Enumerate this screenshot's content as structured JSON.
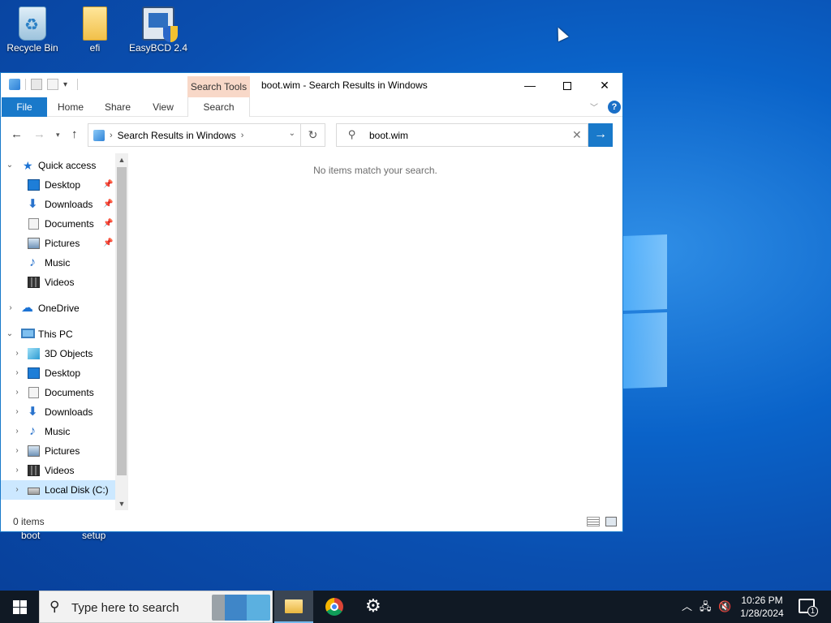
{
  "desktop": {
    "icons": [
      {
        "label": "Recycle Bin",
        "icon": "recycle-bin-icon"
      },
      {
        "label": "efi",
        "icon": "folder-icon"
      },
      {
        "label": "EasyBCD 2.4",
        "icon": "easybcd-icon"
      }
    ],
    "hidden_labels": [
      "boot",
      "setup"
    ]
  },
  "window": {
    "title": "boot.wim - Search Results in Windows",
    "context_tab": "Search Tools",
    "ribbon_tabs": [
      "File",
      "Home",
      "Share",
      "View",
      "Search"
    ],
    "help": "?",
    "address": {
      "location": "Search Results in Windows"
    },
    "search": {
      "value": "boot.wim"
    },
    "empty_message": "No items match your search.",
    "status": {
      "count": "0 items"
    },
    "nav": {
      "quick_access": "Quick access",
      "quick_items": [
        "Desktop",
        "Downloads",
        "Documents",
        "Pictures",
        "Music",
        "Videos"
      ],
      "onedrive": "OneDrive",
      "this_pc": "This PC",
      "pc_items": [
        "3D Objects",
        "Desktop",
        "Documents",
        "Downloads",
        "Music",
        "Pictures",
        "Videos",
        "Local Disk (C:)"
      ]
    }
  },
  "taskbar": {
    "search_placeholder": "Type here to search",
    "apps": [
      "file-explorer-icon",
      "chrome-icon",
      "settings-icon"
    ],
    "time": "10:26 PM",
    "date": "1/28/2024",
    "notification_count": "1"
  },
  "colors": {
    "accent": "#1979ca",
    "taskbar": "#101924",
    "selection": "#cce8ff"
  }
}
